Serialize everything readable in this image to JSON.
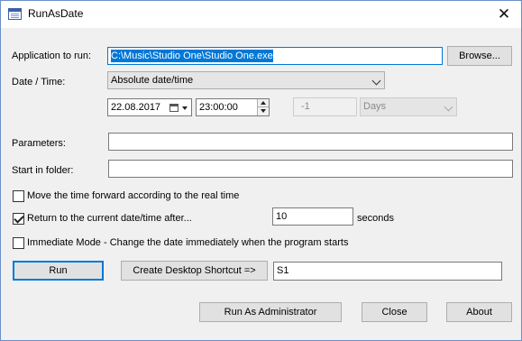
{
  "window": {
    "title": "RunAsDate",
    "close_glyph": "✕"
  },
  "app": {
    "label": "Application to run:",
    "value": "C:\\Music\\Studio One\\Studio One.exe",
    "browse_label": "Browse..."
  },
  "datetime": {
    "label": "Date / Time:",
    "mode_selected": "Absolute date/time",
    "date_value": "22.08.2017",
    "time_value": "23:00:00",
    "offset_value": "-1",
    "unit_selected": "Days"
  },
  "parameters": {
    "label": "Parameters:",
    "value": ""
  },
  "start_folder": {
    "label": "Start in folder:",
    "value": ""
  },
  "options": {
    "move_forward": {
      "label": "Move the time forward according to the real time",
      "checked": false
    },
    "return_after": {
      "label": "Return to the current date/time after...",
      "checked": true,
      "seconds_value": "10",
      "seconds_unit": "seconds"
    },
    "immediate": {
      "label": "Immediate Mode - Change the date immediately when the program starts",
      "checked": false
    }
  },
  "actions": {
    "run_label": "Run",
    "shortcut_label": "Create Desktop Shortcut =>",
    "shortcut_name_value": "S1",
    "run_admin_label": "Run As Administrator",
    "close_label": "Close",
    "about_label": "About"
  },
  "icons": {
    "app_icon": "window-icon",
    "close": "close-icon",
    "calendar": "calendar-icon",
    "dropdown": "chevron-down-icon",
    "spinner": "spinner-arrows-icon"
  }
}
